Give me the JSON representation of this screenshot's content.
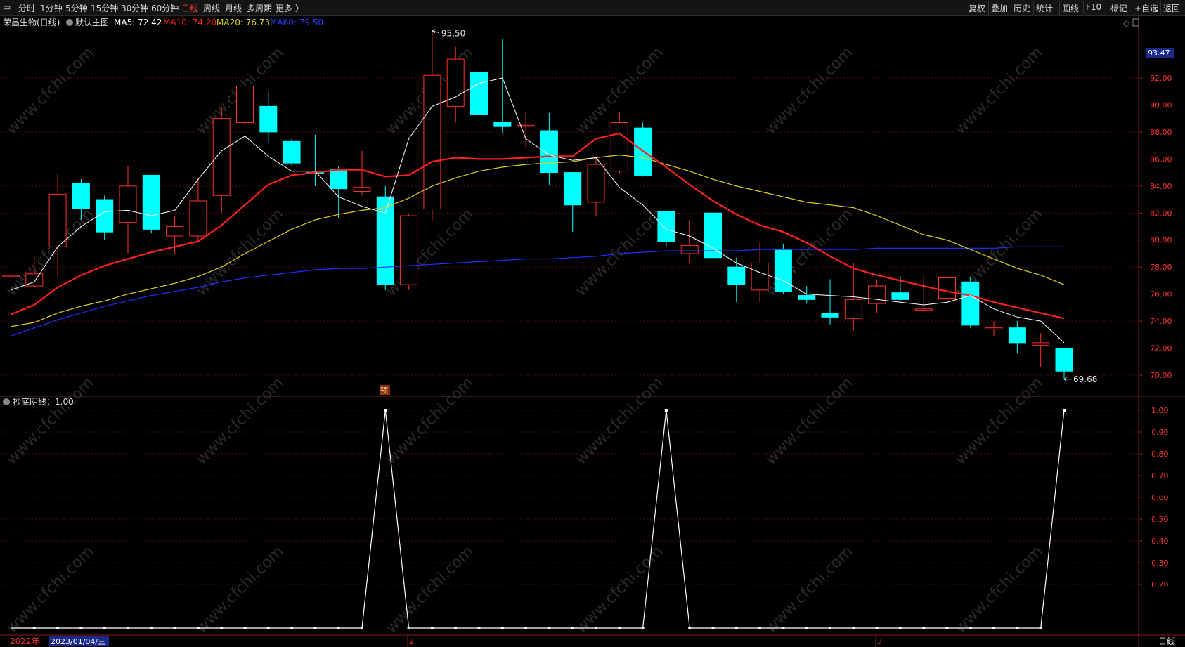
{
  "toolbar": {
    "tabs": [
      "分时",
      "1分钟",
      "5分钟",
      "15分钟",
      "30分钟",
      "60分钟",
      "日线",
      "周线",
      "月线",
      "多周期",
      "更多 〉"
    ],
    "active_tab": "日线",
    "right_buttons": [
      "复权",
      "叠加",
      "历史",
      "统计",
      "画线",
      "F10",
      "标记",
      "+自选",
      "返回"
    ]
  },
  "main_panel": {
    "stock_name": "荣昌生物(日线)",
    "template": "默认主图",
    "ma5_label": "MA5: 72.42",
    "ma10_label": "MA10: 74.20",
    "ma20_label": "MA20: 76.73",
    "ma60_label": "MA60: 79.50",
    "current_price_tag": "93.47",
    "high_label": "95.50",
    "low_label": "69.68",
    "preview_marker": "预",
    "colors": {
      "ma5": "#ffffff",
      "ma10": "#ff2020",
      "ma20": "#e0d020",
      "ma60": "#2030ff",
      "up": "#ff3030",
      "down": "#00ffff"
    }
  },
  "indicator_panel": {
    "label": "抄底阴线：1.00"
  },
  "footer": {
    "year_label": "2022年",
    "date_box": "2023/01/04/三",
    "month_2": "2",
    "month_3": "3",
    "period_label": "日线"
  },
  "watermark": "www.cfchi.com",
  "chart_data": [
    {
      "type": "candlestick",
      "ylim": [
        69.0,
        96.5
      ],
      "y_ticks": [
        70,
        72,
        74,
        76,
        78,
        80,
        82,
        84,
        86,
        88,
        90,
        92
      ],
      "y_tick_labels": [
        "70.00",
        "72.00",
        "74.00",
        "76.00",
        "78.00",
        "80.00",
        "82.00",
        "84.00",
        "86.00",
        "88.00",
        "90.00",
        "92.00"
      ],
      "candles": [
        {
          "o": 77.4,
          "h": 77.9,
          "l": 75.2,
          "c": 77.4
        },
        {
          "o": 76.6,
          "h": 78.9,
          "l": 76.4,
          "c": 77.5
        },
        {
          "o": 79.5,
          "h": 84.9,
          "l": 77.3,
          "c": 83.4
        },
        {
          "o": 84.2,
          "h": 84.5,
          "l": 81.5,
          "c": 82.3
        },
        {
          "o": 83.0,
          "h": 83.3,
          "l": 80.0,
          "c": 80.6
        },
        {
          "o": 81.3,
          "h": 85.5,
          "l": 79.0,
          "c": 84.0
        },
        {
          "o": 84.8,
          "h": 84.8,
          "l": 80.5,
          "c": 80.8
        },
        {
          "o": 80.3,
          "h": 81.8,
          "l": 79.0,
          "c": 81.0
        },
        {
          "o": 80.3,
          "h": 84.6,
          "l": 79.8,
          "c": 82.9
        },
        {
          "o": 83.3,
          "h": 89.8,
          "l": 82.0,
          "c": 89.0
        },
        {
          "o": 88.7,
          "h": 93.7,
          "l": 88.4,
          "c": 91.4
        },
        {
          "o": 89.9,
          "h": 91.0,
          "l": 87.2,
          "c": 88.0
        },
        {
          "o": 87.3,
          "h": 87.5,
          "l": 85.5,
          "c": 85.7
        },
        {
          "o": 85.0,
          "h": 87.8,
          "l": 84.0,
          "c": 84.9
        },
        {
          "o": 85.2,
          "h": 85.5,
          "l": 81.6,
          "c": 83.8
        },
        {
          "o": 83.6,
          "h": 86.6,
          "l": 83.3,
          "c": 83.9
        },
        {
          "o": 83.2,
          "h": 84.0,
          "l": 76.3,
          "c": 76.7
        },
        {
          "o": 76.7,
          "h": 81.9,
          "l": 76.3,
          "c": 81.8
        },
        {
          "o": 82.3,
          "h": 95.5,
          "l": 81.4,
          "c": 92.2
        },
        {
          "o": 89.9,
          "h": 94.3,
          "l": 88.7,
          "c": 93.4
        },
        {
          "o": 92.4,
          "h": 92.7,
          "l": 87.3,
          "c": 89.3
        },
        {
          "o": 88.7,
          "h": 94.9,
          "l": 87.9,
          "c": 88.4
        },
        {
          "o": 88.5,
          "h": 89.5,
          "l": 86.8,
          "c": 88.5
        },
        {
          "o": 88.1,
          "h": 89.4,
          "l": 84.1,
          "c": 85.0
        },
        {
          "o": 85.0,
          "h": 85.0,
          "l": 80.6,
          "c": 82.6
        },
        {
          "o": 82.8,
          "h": 86.1,
          "l": 81.8,
          "c": 85.6
        },
        {
          "o": 85.1,
          "h": 89.5,
          "l": 84.9,
          "c": 88.7
        },
        {
          "o": 88.3,
          "h": 88.7,
          "l": 84.7,
          "c": 84.8
        },
        {
          "o": 82.1,
          "h": 82.1,
          "l": 79.5,
          "c": 79.9
        },
        {
          "o": 79.0,
          "h": 81.5,
          "l": 78.3,
          "c": 79.6
        },
        {
          "o": 82.0,
          "h": 82.0,
          "l": 76.3,
          "c": 78.7
        },
        {
          "o": 78.0,
          "h": 78.7,
          "l": 75.4,
          "c": 76.7
        },
        {
          "o": 76.3,
          "h": 79.9,
          "l": 75.4,
          "c": 78.3
        },
        {
          "o": 79.3,
          "h": 79.7,
          "l": 76.0,
          "c": 76.2
        },
        {
          "o": 75.9,
          "h": 76.6,
          "l": 75.3,
          "c": 75.6
        },
        {
          "o": 74.6,
          "h": 77.1,
          "l": 73.7,
          "c": 74.3
        },
        {
          "o": 74.2,
          "h": 78.3,
          "l": 73.3,
          "c": 75.6
        },
        {
          "o": 75.3,
          "h": 77.1,
          "l": 74.6,
          "c": 76.6
        },
        {
          "o": 76.1,
          "h": 77.3,
          "l": 75.4,
          "c": 75.6
        },
        {
          "o": 74.8,
          "h": 77.4,
          "l": 74.6,
          "c": 74.9
        },
        {
          "o": 75.7,
          "h": 79.4,
          "l": 74.3,
          "c": 77.2
        },
        {
          "o": 76.9,
          "h": 77.3,
          "l": 73.5,
          "c": 73.7
        },
        {
          "o": 73.4,
          "h": 74.0,
          "l": 72.9,
          "c": 73.5
        },
        {
          "o": 73.5,
          "h": 74.0,
          "l": 71.6,
          "c": 72.4
        },
        {
          "o": 72.2,
          "h": 73.1,
          "l": 70.6,
          "c": 72.4
        },
        {
          "o": 72.0,
          "h": 72.0,
          "l": 69.7,
          "c": 70.3
        }
      ],
      "ma5": [
        76.3,
        76.9,
        79.5,
        81.0,
        82.1,
        82.2,
        81.8,
        82.2,
        84.5,
        86.6,
        87.7,
        86.2,
        85.1,
        85.1,
        83.2,
        82.5,
        82.0,
        87.5,
        89.9,
        90.6,
        91.6,
        92.0,
        87.5,
        86.3,
        85.9,
        86.1,
        83.9,
        82.6,
        80.8,
        80.3,
        79.4,
        78.3,
        77.6,
        77.0,
        76.0,
        75.9,
        75.8,
        75.6,
        75.4,
        75.2,
        75.4,
        75.9,
        74.9,
        74.3,
        74.0,
        72.4
      ],
      "ma10": [
        74.5,
        75.2,
        76.5,
        77.4,
        78.1,
        78.6,
        79.1,
        79.5,
        79.9,
        81.1,
        82.6,
        84.1,
        84.8,
        85.0,
        85.2,
        85.2,
        84.7,
        84.8,
        85.8,
        86.1,
        86.0,
        86.0,
        86.1,
        86.2,
        86.2,
        87.5,
        87.9,
        86.6,
        85.4,
        84.1,
        82.9,
        81.9,
        81.1,
        80.6,
        79.8,
        78.8,
        77.9,
        77.4,
        77.0,
        76.6,
        76.2,
        75.9,
        75.4,
        75.0,
        74.6,
        74.2
      ],
      "ma20": [
        73.6,
        73.9,
        74.6,
        75.1,
        75.5,
        76.0,
        76.4,
        76.8,
        77.3,
        78.0,
        79.0,
        79.9,
        80.8,
        81.5,
        81.9,
        82.2,
        82.4,
        83.1,
        84.0,
        84.6,
        85.1,
        85.4,
        85.6,
        85.7,
        85.8,
        86.1,
        86.3,
        86.1,
        85.6,
        85.1,
        84.5,
        84.0,
        83.6,
        83.2,
        82.8,
        82.6,
        82.4,
        81.8,
        81.1,
        80.4,
        80.0,
        79.3,
        78.6,
        77.9,
        77.4,
        76.7
      ],
      "ma60": [
        72.9,
        73.5,
        74.1,
        74.6,
        75.1,
        75.5,
        75.9,
        76.2,
        76.5,
        76.9,
        77.2,
        77.4,
        77.6,
        77.8,
        77.9,
        77.9,
        78.0,
        78.1,
        78.2,
        78.3,
        78.4,
        78.5,
        78.6,
        78.6,
        78.7,
        78.8,
        79.0,
        79.1,
        79.2,
        79.2,
        79.2,
        79.2,
        79.3,
        79.3,
        79.3,
        79.3,
        79.3,
        79.4,
        79.4,
        79.4,
        79.4,
        79.4,
        79.4,
        79.5,
        79.5,
        79.5
      ]
    },
    {
      "type": "line",
      "name": "抄底阴线",
      "ylim": [
        0,
        1.05
      ],
      "y_ticks": [
        0.2,
        0.3,
        0.4,
        0.5,
        0.6,
        0.7,
        0.8,
        0.9,
        1.0
      ],
      "y_tick_labels": [
        "0.20",
        "0.30",
        "0.40",
        "0.50",
        "0.60",
        "0.70",
        "0.80",
        "0.90",
        "1.00"
      ],
      "values": [
        0,
        0,
        0,
        0,
        0,
        0,
        0,
        0,
        0,
        0,
        0,
        0,
        0,
        0,
        0,
        0,
        1,
        0,
        0,
        0,
        0,
        0,
        0,
        0,
        0,
        0,
        0,
        0,
        1,
        0,
        0,
        0,
        0,
        0,
        0,
        0,
        0,
        0,
        0,
        0,
        0,
        0,
        0,
        0,
        0,
        1
      ]
    }
  ]
}
